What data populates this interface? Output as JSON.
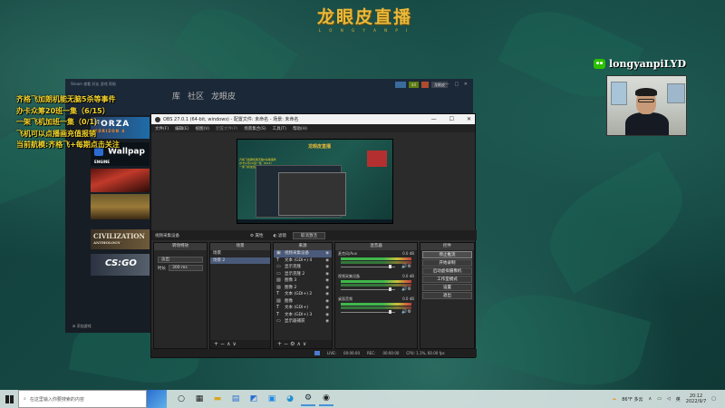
{
  "stream": {
    "logo_title": "龙眼皮直播",
    "logo_sub": "L O N G Y A N P I",
    "overlay_lines": [
      "齐格飞加朗机能无脑5杀等事件",
      "办卡众筹20班一集（6/15）",
      "一架飞机加班一集（0/1）",
      "飞机可以点播画充值报销",
      "当前航模:齐格飞+每期点击关注"
    ],
    "wechat_id": "longyanpiLYD"
  },
  "steam": {
    "top_menu": "Steam  查看  好友  游戏  帮助",
    "nav": [
      "库",
      "社区",
      "龙眼皮"
    ],
    "acct_points": "$4",
    "acct_name": "龙眼皮",
    "window_btns": "— □ ✕",
    "tiles": {
      "forza": "FORZA",
      "forza_sub": "HORIZON 4",
      "wallpaper": "Wallpap",
      "wallpaper_sub": "ENGINE",
      "civ": "CIVILIZATION",
      "civ_sub": "ANTHOLOGY",
      "csgo": "CS:GO"
    },
    "add_game": "添加游戏"
  },
  "obs": {
    "title": "OBS 27.0.1 (64-bit, windows) - 配置文件: 未命名 - 场景: 未命名",
    "window_btns": [
      "—",
      "☐",
      "✕"
    ],
    "menu": [
      "文件(F)",
      "编辑(E)",
      "视图(V)",
      "配置文件(P)",
      "场景集合(S)",
      "工具(T)",
      "帮助(H)"
    ],
    "source_bar": {
      "label": "视频采集设备",
      "props": "属性",
      "filters": "滤镜",
      "deactivate": "取消激活"
    },
    "filters_dock": {
      "header": "转场特效",
      "type_label": "淡出",
      "duration_label": "时长",
      "duration_value": "300 ms"
    },
    "scenes_dock": {
      "header": "场景",
      "items": [
        "场景",
        "场景 2"
      ]
    },
    "sources_dock": {
      "header": "来源",
      "items": [
        {
          "icon": "camera",
          "label": "视频采集设备"
        },
        {
          "icon": "T",
          "label": "文本 (GDI+) 4"
        },
        {
          "icon": "screen",
          "label": "显示克隆"
        },
        {
          "icon": "screen",
          "label": "显示克隆 2"
        },
        {
          "icon": "image",
          "label": "图像 3"
        },
        {
          "icon": "image",
          "label": "图像 2"
        },
        {
          "icon": "T",
          "label": "文本 (GDI+) 2"
        },
        {
          "icon": "image",
          "label": "图像"
        },
        {
          "icon": "T",
          "label": "文本 (GDI+)"
        },
        {
          "icon": "T",
          "label": "文本 (GDI+) 3"
        },
        {
          "icon": "screen",
          "label": "显示器捕获"
        }
      ]
    },
    "mixer_dock": {
      "header": "混音器",
      "tracks": [
        {
          "name": "麦克风/Aux",
          "db": "0.0 dB"
        },
        {
          "name": "视频采集设备",
          "db": "0.0 dB"
        },
        {
          "name": "桌面音频",
          "db": "0.0 dB"
        }
      ]
    },
    "controls_dock": {
      "header": "控件",
      "buttons": [
        "停止推流",
        "开始录制",
        "启动虚拟摄像机",
        "工作室模式",
        "设置",
        "退出"
      ],
      "active_index": 0
    },
    "status": {
      "live": "LIVE:",
      "live_time": "00:00:00",
      "rec": "REC:",
      "rec_time": "00:00:00",
      "cpu": "CPU: 1.1%, 60.00 fps"
    }
  },
  "taskbar": {
    "search_placeholder": "在这里输入你要搜索的内容",
    "weather": "86°F 多云",
    "time": "20:12",
    "date": "2022/9/7",
    "ime": "英"
  }
}
